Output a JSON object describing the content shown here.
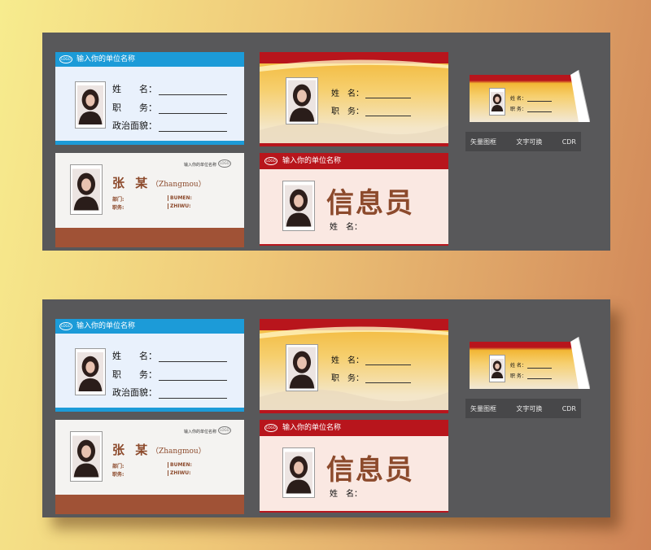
{
  "panels": [
    {
      "card_blue": {
        "header": "输入你的单位名称",
        "logo": "LOGO",
        "name_label": "姓　　名：",
        "position_label": "职　　务：",
        "politics_label": "政治面貌："
      },
      "card_white": {
        "org": "输入你的单位名称",
        "logo": "LOGO",
        "name": "张 某",
        "pinyin": "（Zhangmou）",
        "dept_label": "部门:",
        "job_label": "职务:",
        "dept_en": "BUMEN:",
        "job_en": "ZHIWU:"
      },
      "card_gold": {
        "name_label": "姓　名：",
        "position_label": "职　务："
      },
      "card_red": {
        "header": "输入你的单位名称",
        "logo": "LOGO",
        "title": "信息员",
        "name_label": "姓　名："
      },
      "tent": {
        "name_label": "姓 名：",
        "position_label": "职 务："
      },
      "labels": [
        "矢量图框",
        "文字可换",
        "CDR"
      ]
    },
    {
      "card_blue": {
        "header": "输入你的单位名称",
        "logo": "LOGO",
        "name_label": "姓　　名：",
        "position_label": "职　　务：",
        "politics_label": "政治面貌："
      },
      "card_white": {
        "org": "输入你的单位名称",
        "logo": "LOGO",
        "name": "张 某",
        "pinyin": "（Zhangmou）",
        "dept_label": "部门:",
        "job_label": "职务:",
        "dept_en": "BUMEN:",
        "job_en": "ZHIWU:"
      },
      "card_gold": {
        "name_label": "姓　名：",
        "position_label": "职　务："
      },
      "card_red": {
        "header": "输入你的单位名称",
        "logo": "LOGO",
        "title": "信息员",
        "name_label": "姓　名："
      },
      "tent": {
        "name_label": "姓 名：",
        "position_label": "职 务："
      },
      "labels": [
        "矢量图框",
        "文字可换",
        "CDR"
      ]
    }
  ]
}
